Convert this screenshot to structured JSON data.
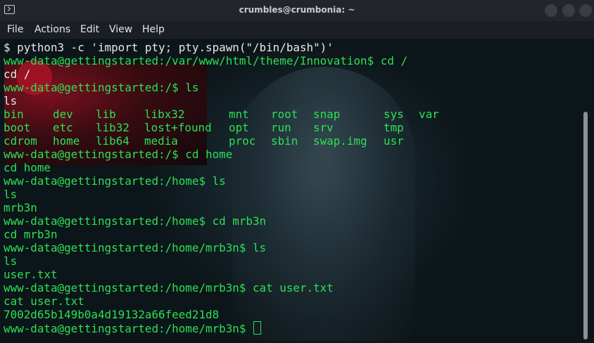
{
  "window": {
    "title": "crumbles@crumbonia: ~"
  },
  "menu": [
    "File",
    "Actions",
    "Edit",
    "View",
    "Help"
  ],
  "terminal": {
    "lines_before": [
      "$ python3 -c 'import pty; pty.spawn(\"/bin/bash\")'",
      "www-data@gettingstarted:/var/www/html/theme/Innovation$ cd /",
      "cd /",
      "www-data@gettingstarted:/$ ls",
      "ls"
    ],
    "ls_rows": [
      [
        "bin",
        "dev",
        "lib",
        "libx32",
        "mnt",
        "root",
        "snap",
        "sys",
        "var"
      ],
      [
        "boot",
        "etc",
        "lib32",
        "lost+found",
        "opt",
        "run",
        "srv",
        "tmp",
        ""
      ],
      [
        "cdrom",
        "home",
        "lib64",
        "media",
        "proc",
        "sbin",
        "swap.img",
        "usr",
        ""
      ]
    ],
    "lines_after": [
      "www-data@gettingstarted:/$ cd home",
      "cd home",
      "www-data@gettingstarted:/home$ ls",
      "ls",
      "mrb3n",
      "www-data@gettingstarted:/home$ cd mrb3n",
      "cd mrb3n",
      "www-data@gettingstarted:/home/mrb3n$ ls",
      "ls",
      "user.txt",
      "www-data@gettingstarted:/home/mrb3n$ cat user.txt",
      "cat user.txt",
      "7002d65b149b0a4d19132a66feed21d8"
    ],
    "prompt": "www-data@gettingstarted:/home/mrb3n$ "
  }
}
